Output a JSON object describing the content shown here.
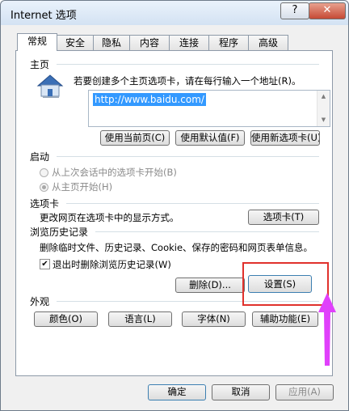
{
  "window": {
    "title": "Internet 选项",
    "help_label": "?",
    "close_label": "✕"
  },
  "tabs": [
    "常规",
    "安全",
    "隐私",
    "内容",
    "连接",
    "程序",
    "高级"
  ],
  "home": {
    "section_title": "主页",
    "description": "若要创建多个主页选项卡，请在每行输入一个地址(R)。",
    "url": "http://www.baidu.com/",
    "buttons": [
      "使用当前页(C)",
      "使用默认值(F)",
      "使用新选项卡(U)"
    ]
  },
  "startup": {
    "section_title": "启动",
    "options": [
      "从上次会话中的选项卡开始(B)",
      "从主页开始(H)"
    ],
    "selected": 1
  },
  "tabs_section": {
    "section_title": "选项卡",
    "description": "更改网页在选项卡中的显示方式。",
    "button": "选项卡(T)"
  },
  "history": {
    "section_title": "浏览历史记录",
    "description": "删除临时文件、历史记录、Cookie、保存的密码和网页表单信息。",
    "checkbox_label": "退出时删除浏览历史记录(W)",
    "checked": true,
    "delete_button": "删除(D)...",
    "settings_button": "设置(S)"
  },
  "appearance": {
    "section_title": "外观",
    "buttons": [
      "颜色(O)",
      "语言(L)",
      "字体(N)",
      "辅助功能(E)"
    ]
  },
  "footer": {
    "ok": "确定",
    "cancel": "取消",
    "apply": "应用(A)"
  },
  "colors": {
    "highlight": "#e0312c",
    "arrow": "#e040fb",
    "selection": "#3399ff"
  }
}
